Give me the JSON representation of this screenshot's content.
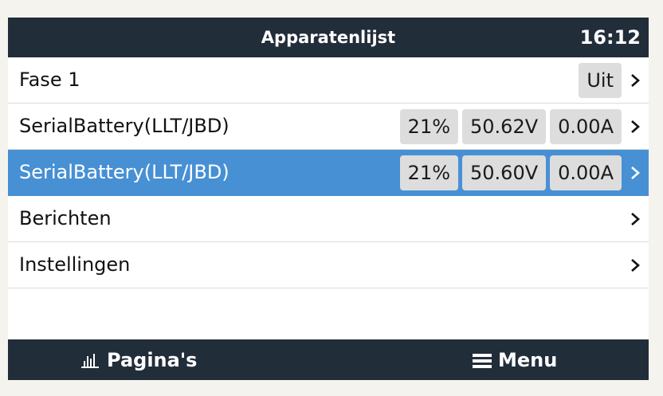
{
  "header": {
    "title": "Apparatenlijst",
    "clock": "16:12"
  },
  "rows": [
    {
      "label": "Fase 1",
      "values": [
        "Uit"
      ]
    },
    {
      "label": "SerialBattery(LLT/JBD)",
      "values": [
        "21%",
        "50.62V",
        "0.00A"
      ]
    },
    {
      "label": "SerialBattery(LLT/JBD)",
      "values": [
        "21%",
        "50.60V",
        "0.00A"
      ],
      "selected": true
    },
    {
      "label": "Berichten",
      "values": []
    },
    {
      "label": "Instellingen",
      "values": []
    }
  ],
  "footer": {
    "pages_label": "Pagina's",
    "menu_label": "Menu"
  },
  "colors": {
    "header_bg": "#222d3a",
    "selected_bg": "#4790d4",
    "badge_bg": "#dddddd"
  },
  "icons": {
    "pages": "bar-chart-icon",
    "menu": "hamburger-icon",
    "row": "chevron-right-icon"
  }
}
